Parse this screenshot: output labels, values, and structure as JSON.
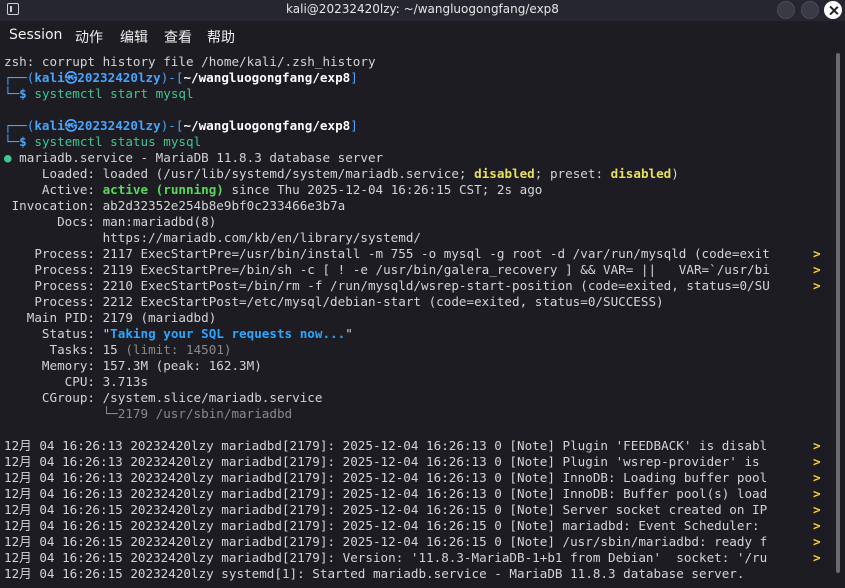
{
  "window": {
    "title": "kali@20232420lzy: ~/wangluogongfang/exp8"
  },
  "menu": [
    "Session",
    "动作",
    "编辑",
    "查看",
    "帮助"
  ],
  "prompt": {
    "user": "kali",
    "at": "㉿",
    "host": "20232420lzy",
    "dir": "~/wangluogongfang/exp8",
    "dollar": "$"
  },
  "lines": {
    "zsh_warn": "zsh: corrupt history file /home/kali/.zsh_history",
    "cmd1": "systemctl start mysql",
    "cmd2": "systemctl status mysql",
    "svc_bullet": "●",
    "svc_name": " mariadb.service - MariaDB 11.8.3 database server",
    "loaded_label": "     Loaded: ",
    "loaded_a": "loaded (/usr/lib/systemd/system/mariadb.service; ",
    "loaded_dis1": "disabled",
    "loaded_b": "; preset: ",
    "loaded_dis2": "disabled",
    "loaded_c": ")",
    "active_label": "     Active: ",
    "active_val": "active (running)",
    "active_rest": " since Thu 2025-12-04 16:26:15 CST; 2s ago",
    "invocation": " Invocation: ab2d32352e254b8e9bf0c233466e3b7a",
    "docs1": "       Docs: man:mariadbd(8)",
    "docs2": "             https://mariadb.com/kb/en/library/systemd/",
    "proc1": "    Process: 2117 ExecStartPre=/usr/bin/install -m 755 -o mysql -g root -d /var/run/mysqld (code=exit",
    "proc2": "    Process: 2119 ExecStartPre=/bin/sh -c [ ! -e /usr/bin/galera_recovery ] && VAR= ||   VAR=`/usr/bi",
    "proc3": "    Process: 2210 ExecStartPost=/bin/rm -f /run/mysqld/wsrep-start-position (code=exited, status=0/SU",
    "proc4": "    Process: 2212 ExecStartPost=/etc/mysql/debian-start (code=exited, status=0/SUCCESS)",
    "mainpid": "   Main PID: 2179 (mariadbd)",
    "status_label": "     Status: \"",
    "status_val": "Taking your SQL requests now...",
    "status_end": "\"",
    "tasks_a": "      Tasks: 15 ",
    "tasks_b": "(limit: 14501)",
    "memory": "     Memory: 157.3M (peak: 162.3M)",
    "cpu": "        CPU: 3.713s",
    "cgroup": "     CGroup: /system.slice/mariadb.service",
    "cgroup_child": "             └─2179 /usr/sbin/mariadbd",
    "log1": "12月 04 16:26:13 20232420lzy mariadbd[2179]: 2025-12-04 16:26:13 0 [Note] Plugin 'FEEDBACK' is disabl",
    "log2": "12月 04 16:26:13 20232420lzy mariadbd[2179]: 2025-12-04 16:26:13 0 [Note] Plugin 'wsrep-provider' is ",
    "log3": "12月 04 16:26:13 20232420lzy mariadbd[2179]: 2025-12-04 16:26:13 0 [Note] InnoDB: Loading buffer pool",
    "log4": "12月 04 16:26:13 20232420lzy mariadbd[2179]: 2025-12-04 16:26:13 0 [Note] InnoDB: Buffer pool(s) load",
    "log5": "12月 04 16:26:15 20232420lzy mariadbd[2179]: 2025-12-04 16:26:15 0 [Note] Server socket created on IP",
    "log6": "12月 04 16:26:15 20232420lzy mariadbd[2179]: 2025-12-04 16:26:15 0 [Note] mariadbd: Event Scheduler: ",
    "log7": "12月 04 16:26:15 20232420lzy mariadbd[2179]: 2025-12-04 16:26:15 0 [Note] /usr/sbin/mariadbd: ready f",
    "log8": "12月 04 16:26:15 20232420lzy mariadbd[2179]: Version: '11.8.3-MariaDB-1+b1 from Debian'  socket: '/ru",
    "log9": "12月 04 16:26:15 20232420lzy systemd[1]: Started mariadb.service - MariaDB 11.8.3 database server.",
    "trunc": ">"
  },
  "colors": {
    "background": "#1c1c22",
    "prompt_blue": "#4aa3ff",
    "active_green": "#57d957",
    "disabled_yellow": "#e8e05a"
  }
}
